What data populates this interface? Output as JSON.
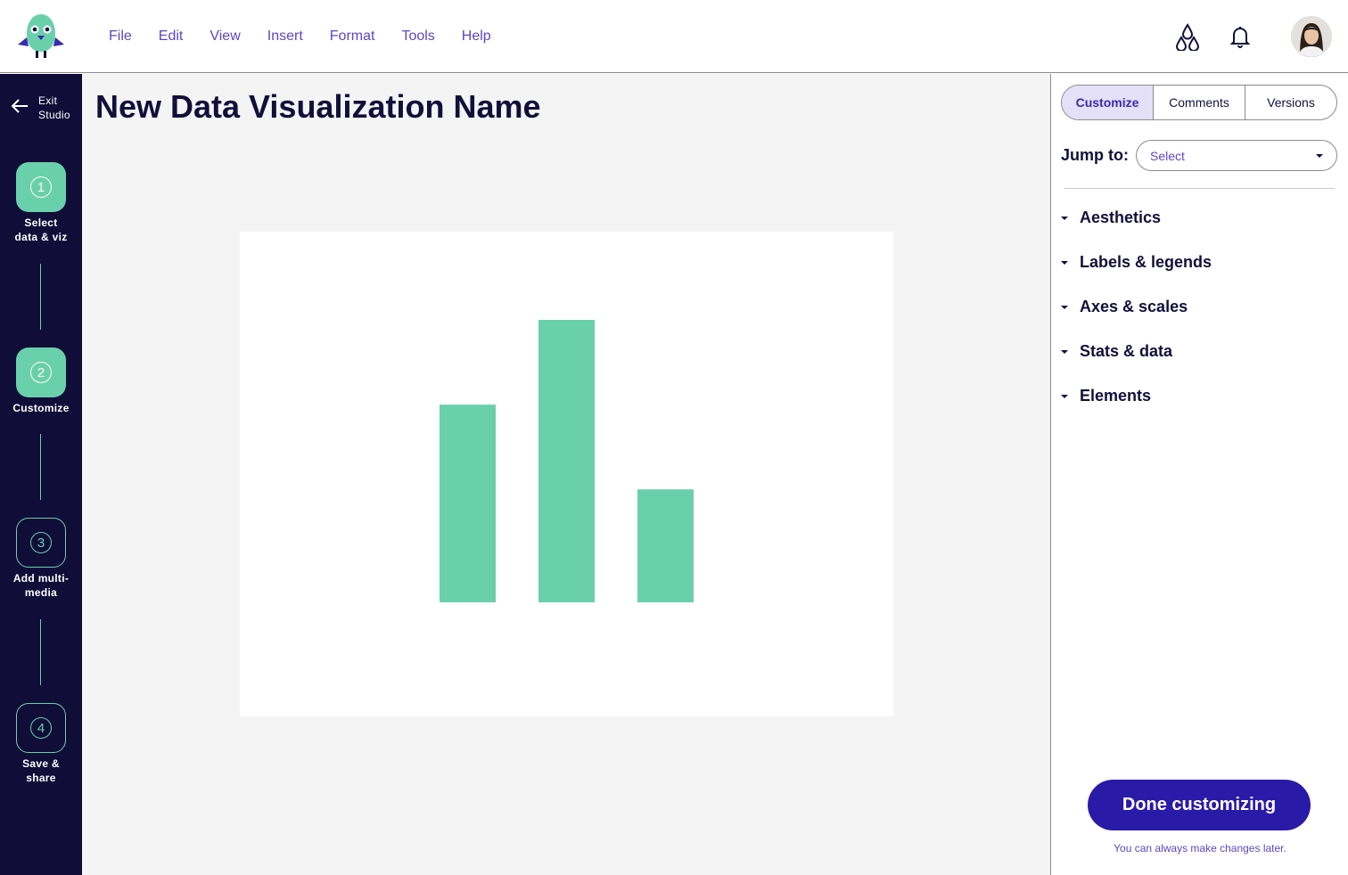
{
  "menu": {
    "items": [
      "File",
      "Edit",
      "View",
      "Insert",
      "Format",
      "Tools",
      "Help"
    ]
  },
  "sidebar": {
    "exit_line1": "Exit",
    "exit_line2": "Studio",
    "steps": [
      {
        "num": "1",
        "line1": "Select",
        "line2": "data & viz"
      },
      {
        "num": "2",
        "line1": "Customize",
        "line2": ""
      },
      {
        "num": "3",
        "line1": "Add multi-",
        "line2": "media"
      },
      {
        "num": "4",
        "line1": "Save &",
        "line2": "share"
      }
    ]
  },
  "main": {
    "title": "New Data Visualization Name"
  },
  "chart_data": {
    "type": "bar",
    "categories": [
      "",
      "",
      ""
    ],
    "values": [
      70,
      100,
      40
    ],
    "ylim": [
      0,
      100
    ],
    "bar_color": "#6ad0ab",
    "axes_visible": false,
    "grid": false
  },
  "panel": {
    "tabs": [
      "Customize",
      "Comments",
      "Versions"
    ],
    "active_tab": "Customize",
    "jump_label": "Jump to:",
    "jump_placeholder": "Select",
    "sections": [
      "Aesthetics",
      "Labels & legends",
      "Axes & scales",
      "Stats & data",
      "Elements"
    ],
    "done_label": "Done customizing",
    "hint": "You can always make changes later."
  },
  "colors": {
    "brand_dark": "#100d38",
    "accent_green": "#6ad0ab",
    "primary_button": "#2a1aa8",
    "link_purple": "#5b47c6"
  },
  "icons": {
    "logo": "bird-mascot-logo",
    "collab": "droplets-icon",
    "notifications": "bell-icon",
    "exit": "arrow-left-icon"
  }
}
